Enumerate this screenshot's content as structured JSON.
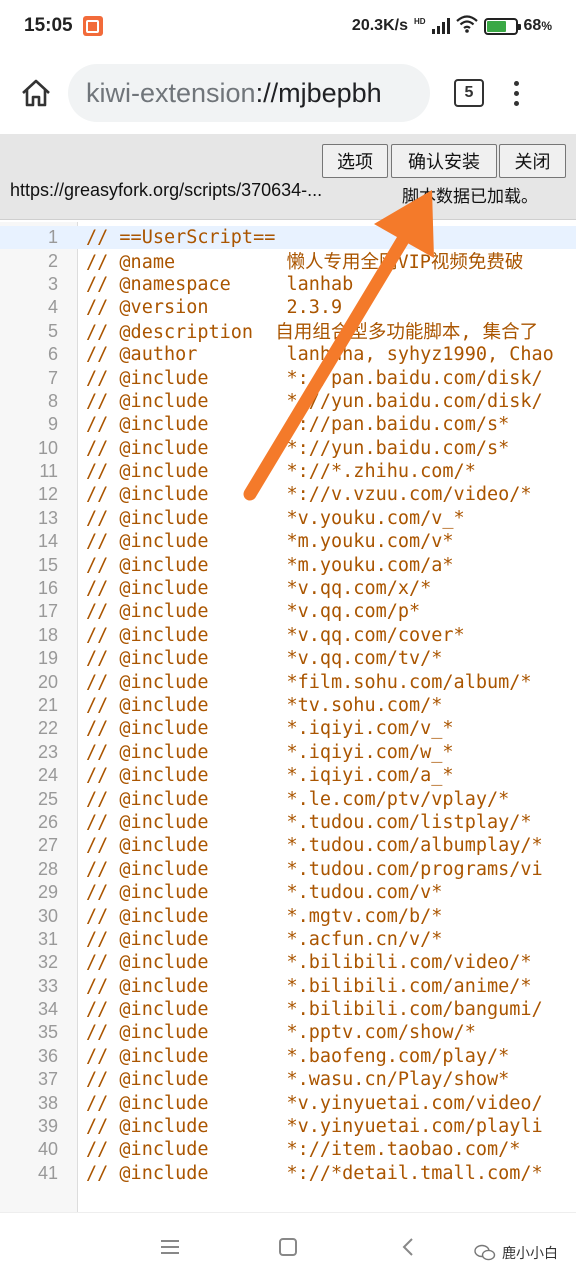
{
  "status_bar": {
    "time": "15:05",
    "network_speed": "20.3K/s",
    "hd_label": "HD",
    "battery": "68"
  },
  "browser": {
    "url_scheme": "kiwi-extension",
    "url_rest": "://mjbepbh",
    "tab_count": "5"
  },
  "install_panel": {
    "options_label": "选项",
    "confirm_label": "确认安装",
    "close_label": "关闭",
    "script_url": "https://greasyfork.org/scripts/370634-...",
    "status_text": "脚本数据已加载。"
  },
  "code_lines": [
    {
      "n": "1",
      "t": "// ==UserScript=="
    },
    {
      "n": "2",
      "t": "// @name          懒人专用全网VIP视频免费破"
    },
    {
      "n": "3",
      "t": "// @namespace     lanhab"
    },
    {
      "n": "4",
      "t": "// @version       2.3.9"
    },
    {
      "n": "5",
      "t": "// @description  自用组合型多功能脚本, 集合了"
    },
    {
      "n": "6",
      "t": "// @author        lanhaha, syhyz1990, Chao"
    },
    {
      "n": "7",
      "t": "// @include       *://pan.baidu.com/disk/"
    },
    {
      "n": "8",
      "t": "// @include       *://yun.baidu.com/disk/"
    },
    {
      "n": "9",
      "t": "// @include       *://pan.baidu.com/s*"
    },
    {
      "n": "10",
      "t": "// @include       *://yun.baidu.com/s*"
    },
    {
      "n": "11",
      "t": "// @include       *://*.zhihu.com/*"
    },
    {
      "n": "12",
      "t": "// @include       *://v.vzuu.com/video/*"
    },
    {
      "n": "13",
      "t": "// @include       *v.youku.com/v_*"
    },
    {
      "n": "14",
      "t": "// @include       *m.youku.com/v*"
    },
    {
      "n": "15",
      "t": "// @include       *m.youku.com/a*"
    },
    {
      "n": "16",
      "t": "// @include       *v.qq.com/x/*"
    },
    {
      "n": "17",
      "t": "// @include       *v.qq.com/p*"
    },
    {
      "n": "18",
      "t": "// @include       *v.qq.com/cover*"
    },
    {
      "n": "19",
      "t": "// @include       *v.qq.com/tv/*"
    },
    {
      "n": "20",
      "t": "// @include       *film.sohu.com/album/*"
    },
    {
      "n": "21",
      "t": "// @include       *tv.sohu.com/*"
    },
    {
      "n": "22",
      "t": "// @include       *.iqiyi.com/v_*"
    },
    {
      "n": "23",
      "t": "// @include       *.iqiyi.com/w_*"
    },
    {
      "n": "24",
      "t": "// @include       *.iqiyi.com/a_*"
    },
    {
      "n": "25",
      "t": "// @include       *.le.com/ptv/vplay/*"
    },
    {
      "n": "26",
      "t": "// @include       *.tudou.com/listplay/*"
    },
    {
      "n": "27",
      "t": "// @include       *.tudou.com/albumplay/*"
    },
    {
      "n": "28",
      "t": "// @include       *.tudou.com/programs/vi"
    },
    {
      "n": "29",
      "t": "// @include       *.tudou.com/v*"
    },
    {
      "n": "30",
      "t": "// @include       *.mgtv.com/b/*"
    },
    {
      "n": "31",
      "t": "// @include       *.acfun.cn/v/*"
    },
    {
      "n": "32",
      "t": "// @include       *.bilibili.com/video/*"
    },
    {
      "n": "33",
      "t": "// @include       *.bilibili.com/anime/*"
    },
    {
      "n": "34",
      "t": "// @include       *.bilibili.com/bangumi/"
    },
    {
      "n": "35",
      "t": "// @include       *.pptv.com/show/*"
    },
    {
      "n": "36",
      "t": "// @include       *.baofeng.com/play/*"
    },
    {
      "n": "37",
      "t": "// @include       *.wasu.cn/Play/show*"
    },
    {
      "n": "38",
      "t": "// @include       *v.yinyuetai.com/video/"
    },
    {
      "n": "39",
      "t": "// @include       *v.yinyuetai.com/playli"
    },
    {
      "n": "40",
      "t": "// @include       *://item.taobao.com/*"
    },
    {
      "n": "41",
      "t": "// @include       *://*detail.tmall.com/*"
    }
  ],
  "watermark": "鹿小小白",
  "colors": {
    "code_text": "#aa5500",
    "annotation_arrow": "#f47a2a",
    "battery_fill": "#3aa845"
  }
}
